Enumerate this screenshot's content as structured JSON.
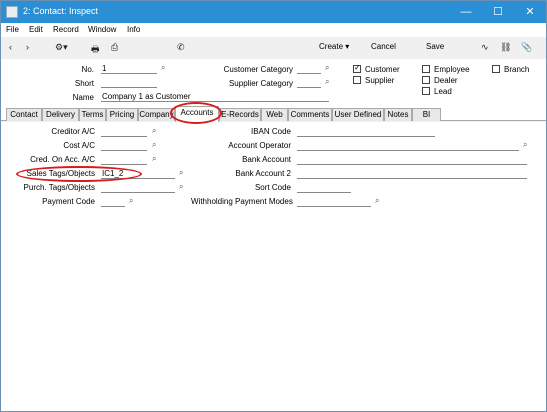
{
  "window": {
    "title": "2: Contact: Inspect",
    "controls": {
      "minimize": "—",
      "maximize": "☐",
      "close": "✕"
    }
  },
  "menu": [
    "File",
    "Edit",
    "Record",
    "Window",
    "Info"
  ],
  "toolbar": {
    "create": "Create",
    "cancel": "Cancel",
    "save": "Save"
  },
  "header": {
    "no_label": "No.",
    "no_value": "1",
    "short_label": "Short",
    "short_value": "",
    "name_label": "Name",
    "name_value": "Company 1 as Customer",
    "customer_category_label": "Customer Category",
    "supplier_category_label": "Supplier Category",
    "customer_label": "Customer",
    "supplier_label": "Supplier",
    "employee_label": "Employee",
    "dealer_label": "Dealer",
    "lead_label": "Lead",
    "branch_label": "Branch"
  },
  "tabs": [
    "Contact",
    "Delivery",
    "Terms",
    "Pricing",
    "Company",
    "Accounts",
    "E-Records",
    "Web",
    "Comments",
    "User Defined",
    "Notes",
    "BI"
  ],
  "accounts": {
    "creditor_ac_label": "Creditor A/C",
    "cost_ac_label": "Cost A/C",
    "cred_on_acc_label": "Cred. On Acc. A/C",
    "sales_tags_label": "Sales Tags/Objects",
    "sales_tags_value": "IC1_2",
    "purch_tags_label": "Purch. Tags/Objects",
    "payment_code_label": "Payment Code",
    "iban_code_label": "IBAN Code",
    "account_operator_label": "Account Operator",
    "bank_account_label": "Bank Account",
    "bank_account_2_label": "Bank Account 2",
    "sort_code_label": "Sort Code",
    "withholding_label": "Withholding Payment Modes"
  }
}
